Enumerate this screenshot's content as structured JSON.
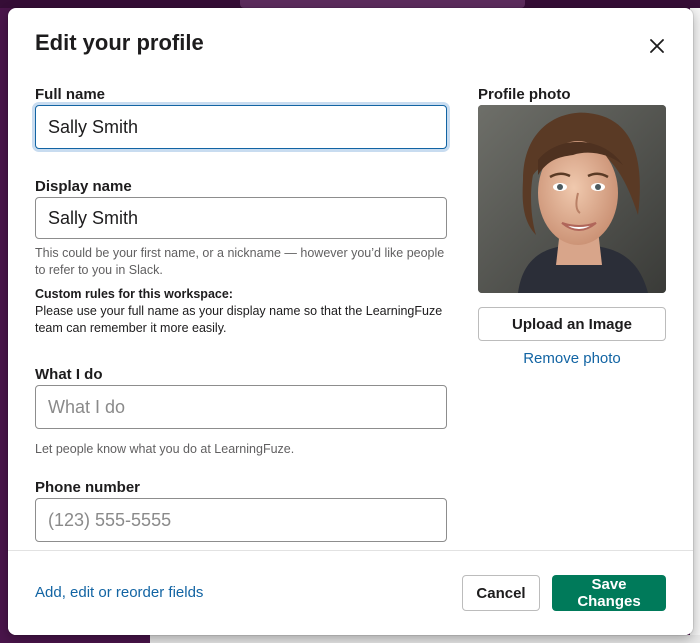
{
  "modal": {
    "title": "Edit your profile",
    "close_icon": "close-icon"
  },
  "form": {
    "full_name": {
      "label": "Full name",
      "value": "Sally Smith"
    },
    "display_name": {
      "label": "Display name",
      "value": "Sally Smith",
      "hint": "This could be your first name, or a nickname — however you’d like people to refer to you in Slack.",
      "rules_title": "Custom rules for this workspace:",
      "rules_text": "Please use your full name as your display name so that the LearningFuze team can remember it more easily."
    },
    "what_i_do": {
      "label": "What I do",
      "placeholder": "What I do",
      "hint": "Let people know what you do at LearningFuze."
    },
    "phone": {
      "label": "Phone number",
      "placeholder": "(123) 555-5555"
    }
  },
  "photo": {
    "label": "Profile photo",
    "upload_label": "Upload an Image",
    "remove_label": "Remove photo"
  },
  "footer": {
    "fields_link": "Add, edit or reorder fields",
    "cancel_label": "Cancel",
    "save_label": "Save Changes"
  },
  "colors": {
    "primary": "#007a5a",
    "link": "#1264a3",
    "focus_ring": "#c8dcf0",
    "backdrop": "#4a154b"
  }
}
